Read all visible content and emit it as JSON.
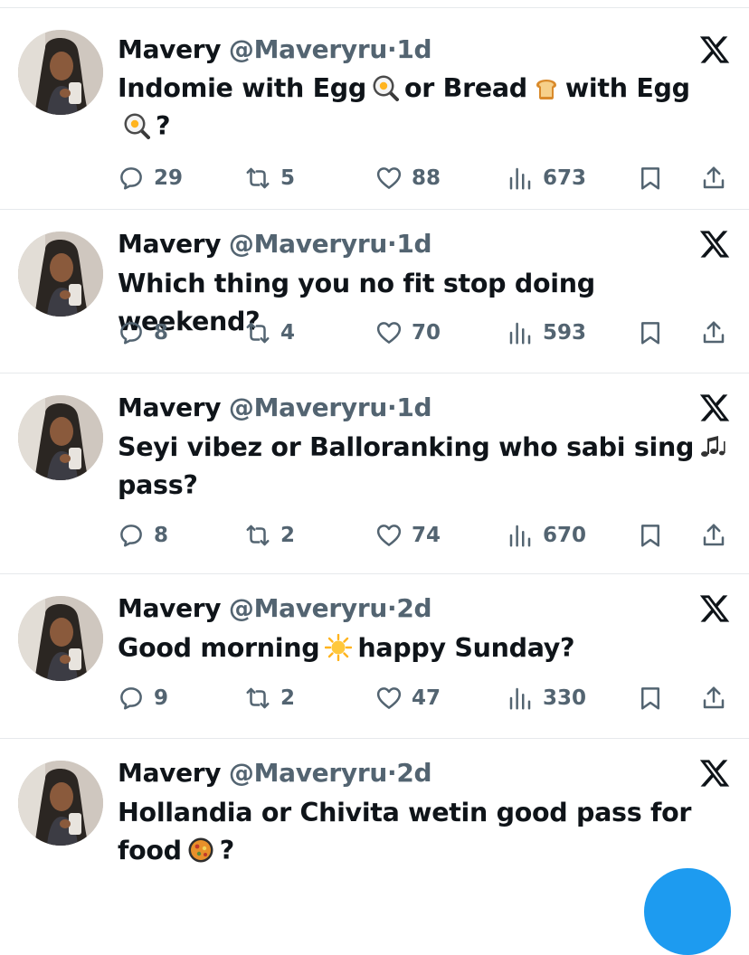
{
  "tweets": [
    {
      "name": "Mavery",
      "handle": "@Maveryru",
      "time": "1d",
      "lines": [
        {
          "segments": [
            {
              "t": "Indomie with Egg"
            },
            {
              "emoji": "frying-pan-egg"
            },
            {
              "t": "or Bread"
            },
            {
              "emoji": "bread"
            },
            {
              "t": "with Egg"
            }
          ]
        },
        {
          "segments": [
            {
              "emoji": "frying-pan-egg"
            },
            {
              "t": "?"
            }
          ]
        }
      ],
      "replies": "29",
      "retweets": "5",
      "likes": "88",
      "views": "673"
    },
    {
      "name": "Mavery",
      "handle": "@Maveryru",
      "time": "1d",
      "lines": [
        {
          "segments": [
            {
              "t": "Which thing you no fit stop doing weekend?"
            }
          ]
        }
      ],
      "replies": "8",
      "retweets": "4",
      "likes": "70",
      "views": "593"
    },
    {
      "name": "Mavery",
      "handle": "@Maveryru",
      "time": "1d",
      "lines": [
        {
          "segments": [
            {
              "t": "Seyi vibez or Balloranking who sabi sing"
            },
            {
              "emoji": "musical-notes"
            }
          ]
        },
        {
          "segments": [
            {
              "t": "pass?"
            }
          ]
        }
      ],
      "replies": "8",
      "retweets": "2",
      "likes": "74",
      "views": "670"
    },
    {
      "name": "Mavery",
      "handle": "@Maveryru",
      "time": "2d",
      "lines": [
        {
          "segments": [
            {
              "t": "Good morning"
            },
            {
              "emoji": "sun"
            },
            {
              "t": "happy Sunday?"
            }
          ]
        }
      ],
      "replies": "9",
      "retweets": "2",
      "likes": "47",
      "views": "330"
    },
    {
      "name": "Mavery",
      "handle": "@Maveryru",
      "time": "2d",
      "lines": [
        {
          "segments": [
            {
              "t": "Hollandia or Chivita wetin good pass for"
            }
          ]
        },
        {
          "segments": [
            {
              "t": "food"
            },
            {
              "emoji": "paella"
            },
            {
              "t": "?"
            }
          ]
        }
      ],
      "replies": "",
      "retweets": "",
      "likes": "",
      "views": ""
    }
  ],
  "icons": {
    "reply": "reply-icon",
    "retweet": "retweet-icon",
    "like": "heart-icon",
    "views": "views-icon",
    "bookmark": "bookmark-icon",
    "share": "share-icon",
    "more": "x-logo-icon"
  },
  "colors": {
    "text": "#0f1419",
    "secondary": "#536471",
    "divider": "#e6e9ec",
    "accent": "#1d9bf0"
  }
}
